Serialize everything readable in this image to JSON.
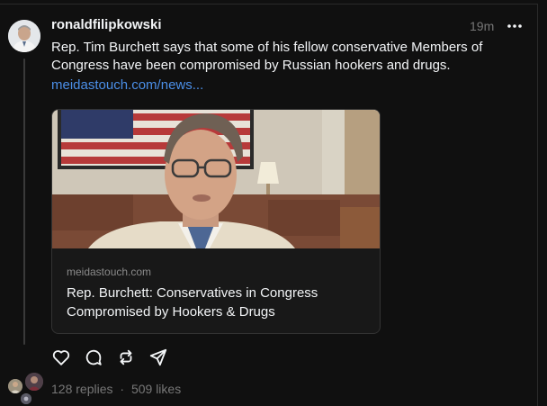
{
  "post": {
    "username": "ronaldfilipkowski",
    "timestamp": "19m",
    "more_label": "•••",
    "text": "Rep. Tim Burchett says that some of his fellow conservative Members of Congress have been compromised by Russian hookers and drugs.",
    "link_text": "meidastouch.com/news..."
  },
  "card": {
    "domain": "meidastouch.com",
    "title": "Rep. Burchett: Conservatives in Congress Compromised by Hookers & Drugs"
  },
  "actions": {
    "icons": [
      "heart-icon",
      "comment-icon",
      "repost-icon",
      "share-icon"
    ]
  },
  "stats": {
    "replies": "128 replies",
    "separator": "·",
    "likes": "509 likes"
  },
  "colors": {
    "background": "#101010",
    "text": "#f3f5f7",
    "muted": "#777777",
    "link": "#4b8fe8"
  }
}
